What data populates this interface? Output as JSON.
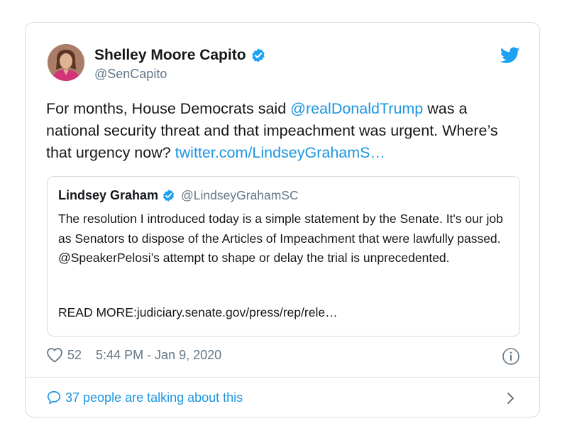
{
  "author": {
    "name": "Shelley Moore Capito",
    "handle": "@SenCapito",
    "verified": true
  },
  "tweet": {
    "text_before": "For months, House Democrats said ",
    "mention": "@realDonaldTrump",
    "text_middle": " was a national security threat and that impeachment was urgent. Where’s that urgency now? ",
    "link": "twitter.com/LindseyGrahamS…"
  },
  "quoted": {
    "name": "Lindsey Graham",
    "handle": "@LindseyGrahamSC",
    "verified": true,
    "body": "The resolution I introduced today is a simple statement by the Senate.  It's our job as Senators to dispose of the Articles of Impeachment that were lawfully passed. @SpeakerPelosi’s attempt to shape or delay the trial is unprecedented.",
    "read_more": "READ MORE:judiciary.senate.gov/press/rep/rele…"
  },
  "meta": {
    "likes": "52",
    "timestamp": "5:44 PM - Jan 9, 2020"
  },
  "footer": {
    "talking": "37 people are talking about this"
  },
  "colors": {
    "link": "#1b95e0",
    "secondary_text": "#657786",
    "border": "#d4dbe0"
  },
  "icons": [
    "verified-icon",
    "twitter-bird-icon",
    "heart-icon",
    "info-icon",
    "comment-bubble-icon",
    "chevron-right-icon"
  ]
}
